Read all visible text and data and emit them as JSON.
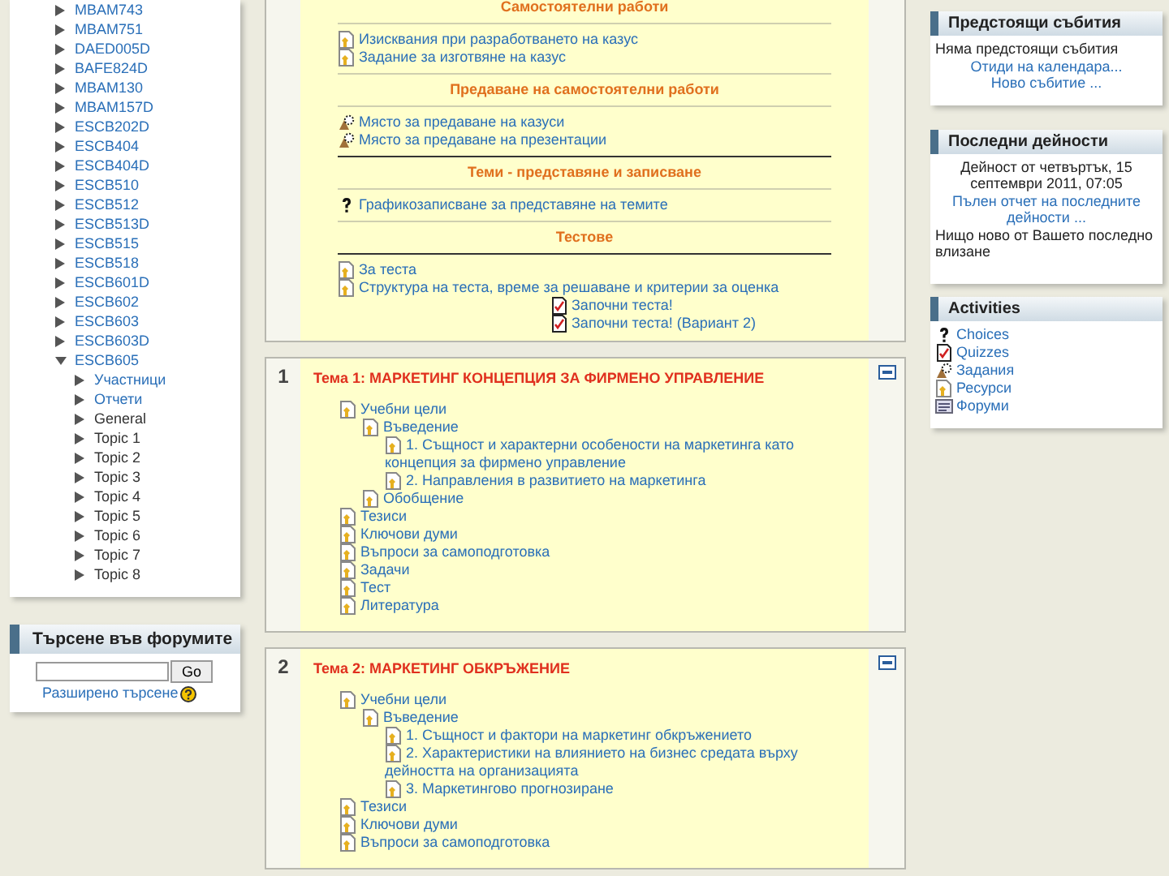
{
  "course_nav": {
    "items": [
      {
        "text": "MBAM743",
        "link": true
      },
      {
        "text": "MBAM751",
        "link": true
      },
      {
        "text": "DAED005D",
        "link": true
      },
      {
        "text": "BAFE824D",
        "link": true
      },
      {
        "text": "MBAM130",
        "link": true
      },
      {
        "text": "MBAM157D",
        "link": true
      },
      {
        "text": "ESCB202D",
        "link": true
      },
      {
        "text": "ESCB404",
        "link": true
      },
      {
        "text": "ESCB404D",
        "link": true
      },
      {
        "text": "ESCB510",
        "link": true
      },
      {
        "text": "ESCB512",
        "link": true
      },
      {
        "text": "ESCB513D",
        "link": true
      },
      {
        "text": "ESCB515",
        "link": true
      },
      {
        "text": "ESCB518",
        "link": true
      },
      {
        "text": "ESCB601D",
        "link": true
      },
      {
        "text": "ESCB602",
        "link": true
      },
      {
        "text": "ESCB603",
        "link": true
      },
      {
        "text": "ESCB603D",
        "link": true
      },
      {
        "text": "ESCB605",
        "link": true,
        "expanded": true,
        "children": [
          {
            "text": "Участници",
            "link": true
          },
          {
            "text": "Отчети",
            "link": true
          },
          {
            "text": "General",
            "link": false
          },
          {
            "text": "Topic 1",
            "link": false
          },
          {
            "text": "Topic 2",
            "link": false
          },
          {
            "text": "Topic 3",
            "link": false
          },
          {
            "text": "Topic 4",
            "link": false
          },
          {
            "text": "Topic 5",
            "link": false
          },
          {
            "text": "Topic 6",
            "link": false
          },
          {
            "text": "Topic 7",
            "link": false
          },
          {
            "text": "Topic 8",
            "link": false
          }
        ]
      }
    ]
  },
  "forum_search": {
    "title": "Търсене във форумите",
    "button": "Go",
    "advanced_link": "Разширено търсене"
  },
  "top_section": {
    "items": [
      {
        "kind": "heading",
        "text": "Самостоятелни работи"
      },
      {
        "kind": "rule",
        "thick": false
      },
      {
        "kind": "resource",
        "text": "Изисквания при разработването на казус"
      },
      {
        "kind": "resource",
        "text": "Задание за изготвяне на казус"
      },
      {
        "kind": "rule",
        "thick": false
      },
      {
        "kind": "heading",
        "text": "Предаване на самостоятелни работи"
      },
      {
        "kind": "rule",
        "thick": false
      },
      {
        "kind": "assignment",
        "text": "Място за предаване на казуси"
      },
      {
        "kind": "assignment",
        "text": "Място за предаване на презентации"
      },
      {
        "kind": "rule",
        "thick": true
      },
      {
        "kind": "heading",
        "text": "Теми - представяне и записване"
      },
      {
        "kind": "rule",
        "thick": false
      },
      {
        "kind": "choice",
        "text": "Графикозаписване за представяне на темите"
      },
      {
        "kind": "rule",
        "thick": false
      },
      {
        "kind": "heading",
        "text": "Тестове"
      },
      {
        "kind": "rule",
        "thick": true
      },
      {
        "kind": "resource",
        "text": "За теста"
      },
      {
        "kind": "resource",
        "text": "Структура на теста, време за решаване и критерии за оценка"
      },
      {
        "kind": "quiz",
        "text": "Започни теста!"
      },
      {
        "kind": "quiz",
        "text": "Започни теста! (Вариант 2)"
      }
    ]
  },
  "sections": [
    {
      "number": "1",
      "title": "Тема 1: МАРКЕТИНГ КОНЦЕПЦИЯ ЗА ФИРМЕНО УПРАВЛЕНИЕ",
      "items": [
        {
          "text": "Учебни цели",
          "children": [
            {
              "text": "Въведение",
              "children": [
                {
                  "text": "1. Същност и характерни особености на маркетинга като концепция за фирмено управление"
                },
                {
                  "text": "2. Направления в развитието на маркетинга"
                }
              ]
            },
            {
              "text": "Обобщение"
            }
          ]
        },
        {
          "text": "Тезиси"
        },
        {
          "text": "Ключови думи"
        },
        {
          "text": "Въпроси за самоподготовка"
        },
        {
          "text": "Задачи"
        },
        {
          "text": "Тест"
        },
        {
          "text": "Литература"
        }
      ]
    },
    {
      "number": "2",
      "title": "Тема 2: МАРКЕТИНГ ОБКРЪЖЕНИЕ",
      "items": [
        {
          "text": "Учебни цели",
          "children": [
            {
              "text": "Въведение",
              "children": [
                {
                  "text": "1. Същност и фактори на маркетинг обкръжението"
                },
                {
                  "text": "2. Характеристики на влиянието на бизнес средата върху дейността на организацията"
                },
                {
                  "text": "3. Маркетингово прогнозиране"
                }
              ]
            }
          ]
        },
        {
          "text": "Тезиси"
        },
        {
          "text": "Ключови думи"
        },
        {
          "text": "Въпроси за самоподготовка"
        }
      ]
    }
  ],
  "upcoming_events": {
    "title": "Предстоящи събития",
    "lines": [
      {
        "text": "Няма предстоящи събития",
        "kind": "note"
      },
      {
        "text": "Отиди на календара...",
        "kind": "link"
      },
      {
        "text": "Ново събитие ...",
        "kind": "link"
      }
    ]
  },
  "recent_activity": {
    "title": "Последни дейности",
    "lines": [
      {
        "text": "Дейност от четвъртък, 15 септември 2011, 07:05",
        "kind": "timestamp"
      },
      {
        "text": "Пълен отчет на последните дейности ...",
        "kind": "link"
      },
      {
        "text": "Нищо ново от Вашето последно влизане",
        "kind": "note"
      }
    ]
  },
  "activities": {
    "title": "Activities",
    "items": [
      {
        "kind": "choice",
        "text": "Choices"
      },
      {
        "kind": "quiz",
        "text": "Quizzes"
      },
      {
        "kind": "assignment",
        "text": "Задания"
      },
      {
        "kind": "resource",
        "text": "Ресурси"
      },
      {
        "kind": "forum",
        "text": "Форуми"
      }
    ]
  }
}
